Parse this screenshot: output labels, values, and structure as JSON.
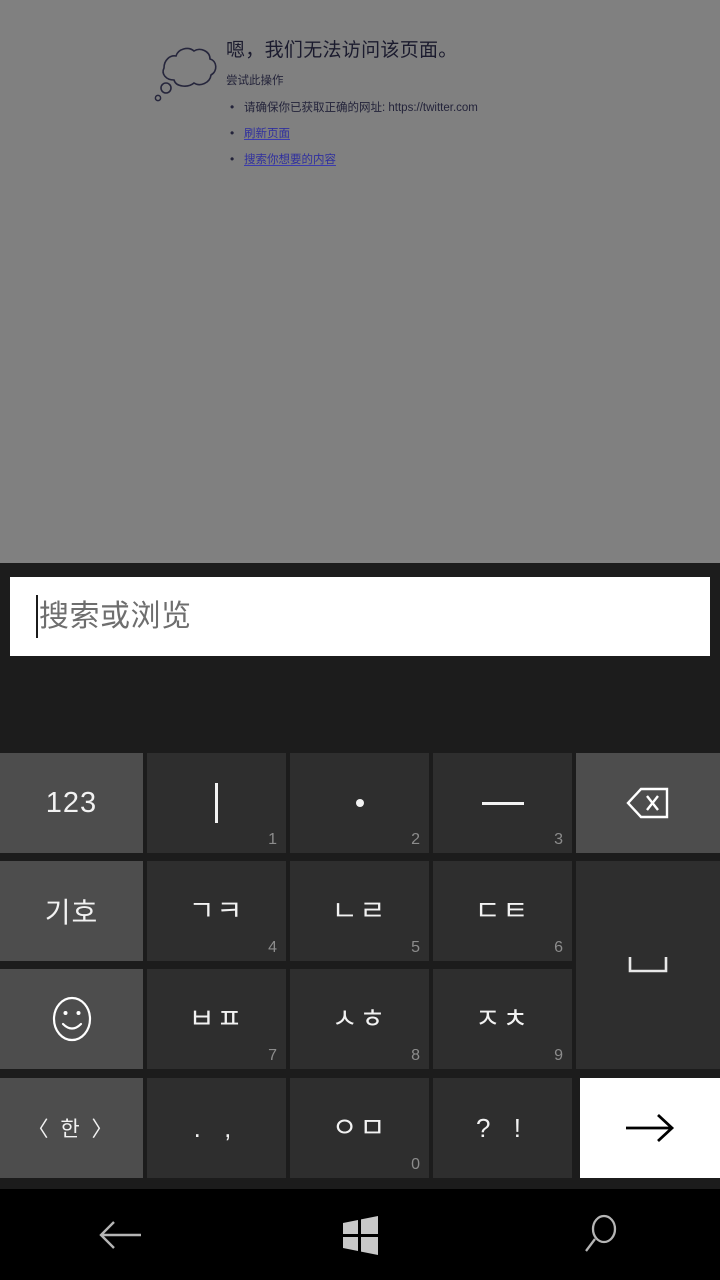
{
  "page": {
    "icon_name": "thought-bubble-icon",
    "title": "嗯，我们无法访问该页面。",
    "subtitle": "尝试此操作",
    "suggestions": [
      {
        "text": "请确保你已获取正确的网址: https://twitter.com",
        "is_link": false
      },
      {
        "text": "刷新页面",
        "is_link": true
      },
      {
        "text": "搜索你想要的内容",
        "is_link": true
      }
    ],
    "background_color": "#808080",
    "link_color": "#2f2f9e"
  },
  "search": {
    "placeholder": "搜索或浏览",
    "value": "",
    "cursor_visible": true
  },
  "keyboard": {
    "layout": "korean-12key",
    "rows": [
      [
        {
          "label": "123",
          "num": "",
          "type": "function",
          "name": "key-numbers"
        },
        {
          "label": "ㅣ",
          "num": "1",
          "type": "normal",
          "name": "key-i"
        },
        {
          "label": "·",
          "num": "2",
          "type": "normal",
          "name": "key-dot"
        },
        {
          "label": "ㅡ",
          "num": "3",
          "type": "normal",
          "name": "key-eu"
        },
        {
          "label": "⌫",
          "num": "",
          "type": "function",
          "name": "key-backspace"
        }
      ],
      [
        {
          "label": "기호",
          "num": "",
          "type": "function",
          "name": "key-symbols"
        },
        {
          "label": "ㄱㅋ",
          "num": "4",
          "type": "normal",
          "name": "key-giyeok-kieuk"
        },
        {
          "label": "ㄴㄹ",
          "num": "5",
          "type": "normal",
          "name": "key-nieun-rieul"
        },
        {
          "label": "ㄷㅌ",
          "num": "6",
          "type": "normal",
          "name": "key-digeut-tieut"
        },
        {
          "label": "␣",
          "num": "",
          "type": "normal",
          "name": "key-space"
        }
      ],
      [
        {
          "label": "☺",
          "num": "",
          "type": "function",
          "name": "key-emoji"
        },
        {
          "label": "ㅂㅍ",
          "num": "7",
          "type": "normal",
          "name": "key-bieup-pieup"
        },
        {
          "label": "ㅅㅎ",
          "num": "8",
          "type": "normal",
          "name": "key-siot-hieut"
        },
        {
          "label": "ㅈㅊ",
          "num": "9",
          "type": "normal",
          "name": "key-jieut-chieut"
        }
      ],
      [
        {
          "label": "〈 한 〉",
          "num": "",
          "type": "function",
          "name": "key-language-korean"
        },
        {
          "label": ". ,",
          "num": "",
          "type": "normal",
          "name": "key-period-comma"
        },
        {
          "label": "ㅇㅁ",
          "num": "0",
          "type": "normal",
          "name": "key-ieung-mieum"
        },
        {
          "label": "? !",
          "num": "",
          "type": "normal",
          "name": "key-question-exclamation"
        },
        {
          "label": "→",
          "num": "",
          "type": "accent",
          "name": "key-enter"
        }
      ]
    ],
    "key_color": "#2e2e2e",
    "function_key_color": "#4d4d4d",
    "accent_key_color": "#ffffff",
    "panel_color": "#1c1c1c"
  },
  "navbar": {
    "buttons": [
      {
        "name": "nav-back-button",
        "icon": "back-arrow-icon"
      },
      {
        "name": "nav-start-button",
        "icon": "windows-logo-icon"
      },
      {
        "name": "nav-search-button",
        "icon": "search-icon"
      }
    ]
  }
}
